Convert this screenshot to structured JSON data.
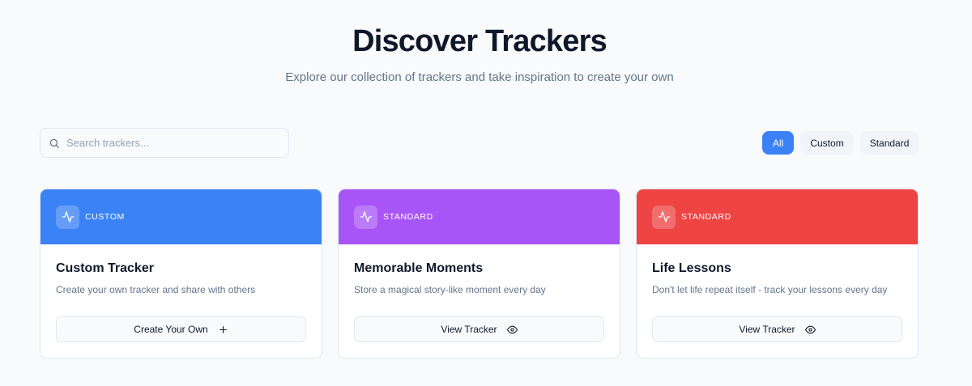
{
  "header": {
    "title": "Discover Trackers",
    "subtitle": "Explore our collection of trackers and take inspiration to create your own"
  },
  "search": {
    "placeholder": "Search trackers...",
    "value": ""
  },
  "filters": [
    {
      "label": "All",
      "active": true
    },
    {
      "label": "Custom",
      "active": false
    },
    {
      "label": "Standard",
      "active": false
    }
  ],
  "colors": {
    "accent": "#3b82f6",
    "custom": "#3b82f6",
    "standard_purple": "#a855f7",
    "standard_red": "#ef4444"
  },
  "cards": [
    {
      "badge": "CUSTOM",
      "header_color": "#3b82f6",
      "icon": "activity-icon",
      "title": "Custom Tracker",
      "description": "Create your own tracker and share with others",
      "action_label": "Create Your Own",
      "action_icon": "plus-icon"
    },
    {
      "badge": "STANDARD",
      "header_color": "#a855f7",
      "icon": "activity-icon",
      "title": "Memorable Moments",
      "description": "Store a magical story-like moment every day",
      "action_label": "View Tracker",
      "action_icon": "eye-icon"
    },
    {
      "badge": "STANDARD",
      "header_color": "#ef4444",
      "icon": "activity-icon",
      "title": "Life Lessons",
      "description": "Don't let life repeat itself - track your lessons every day",
      "action_label": "View Tracker",
      "action_icon": "eye-icon"
    }
  ]
}
